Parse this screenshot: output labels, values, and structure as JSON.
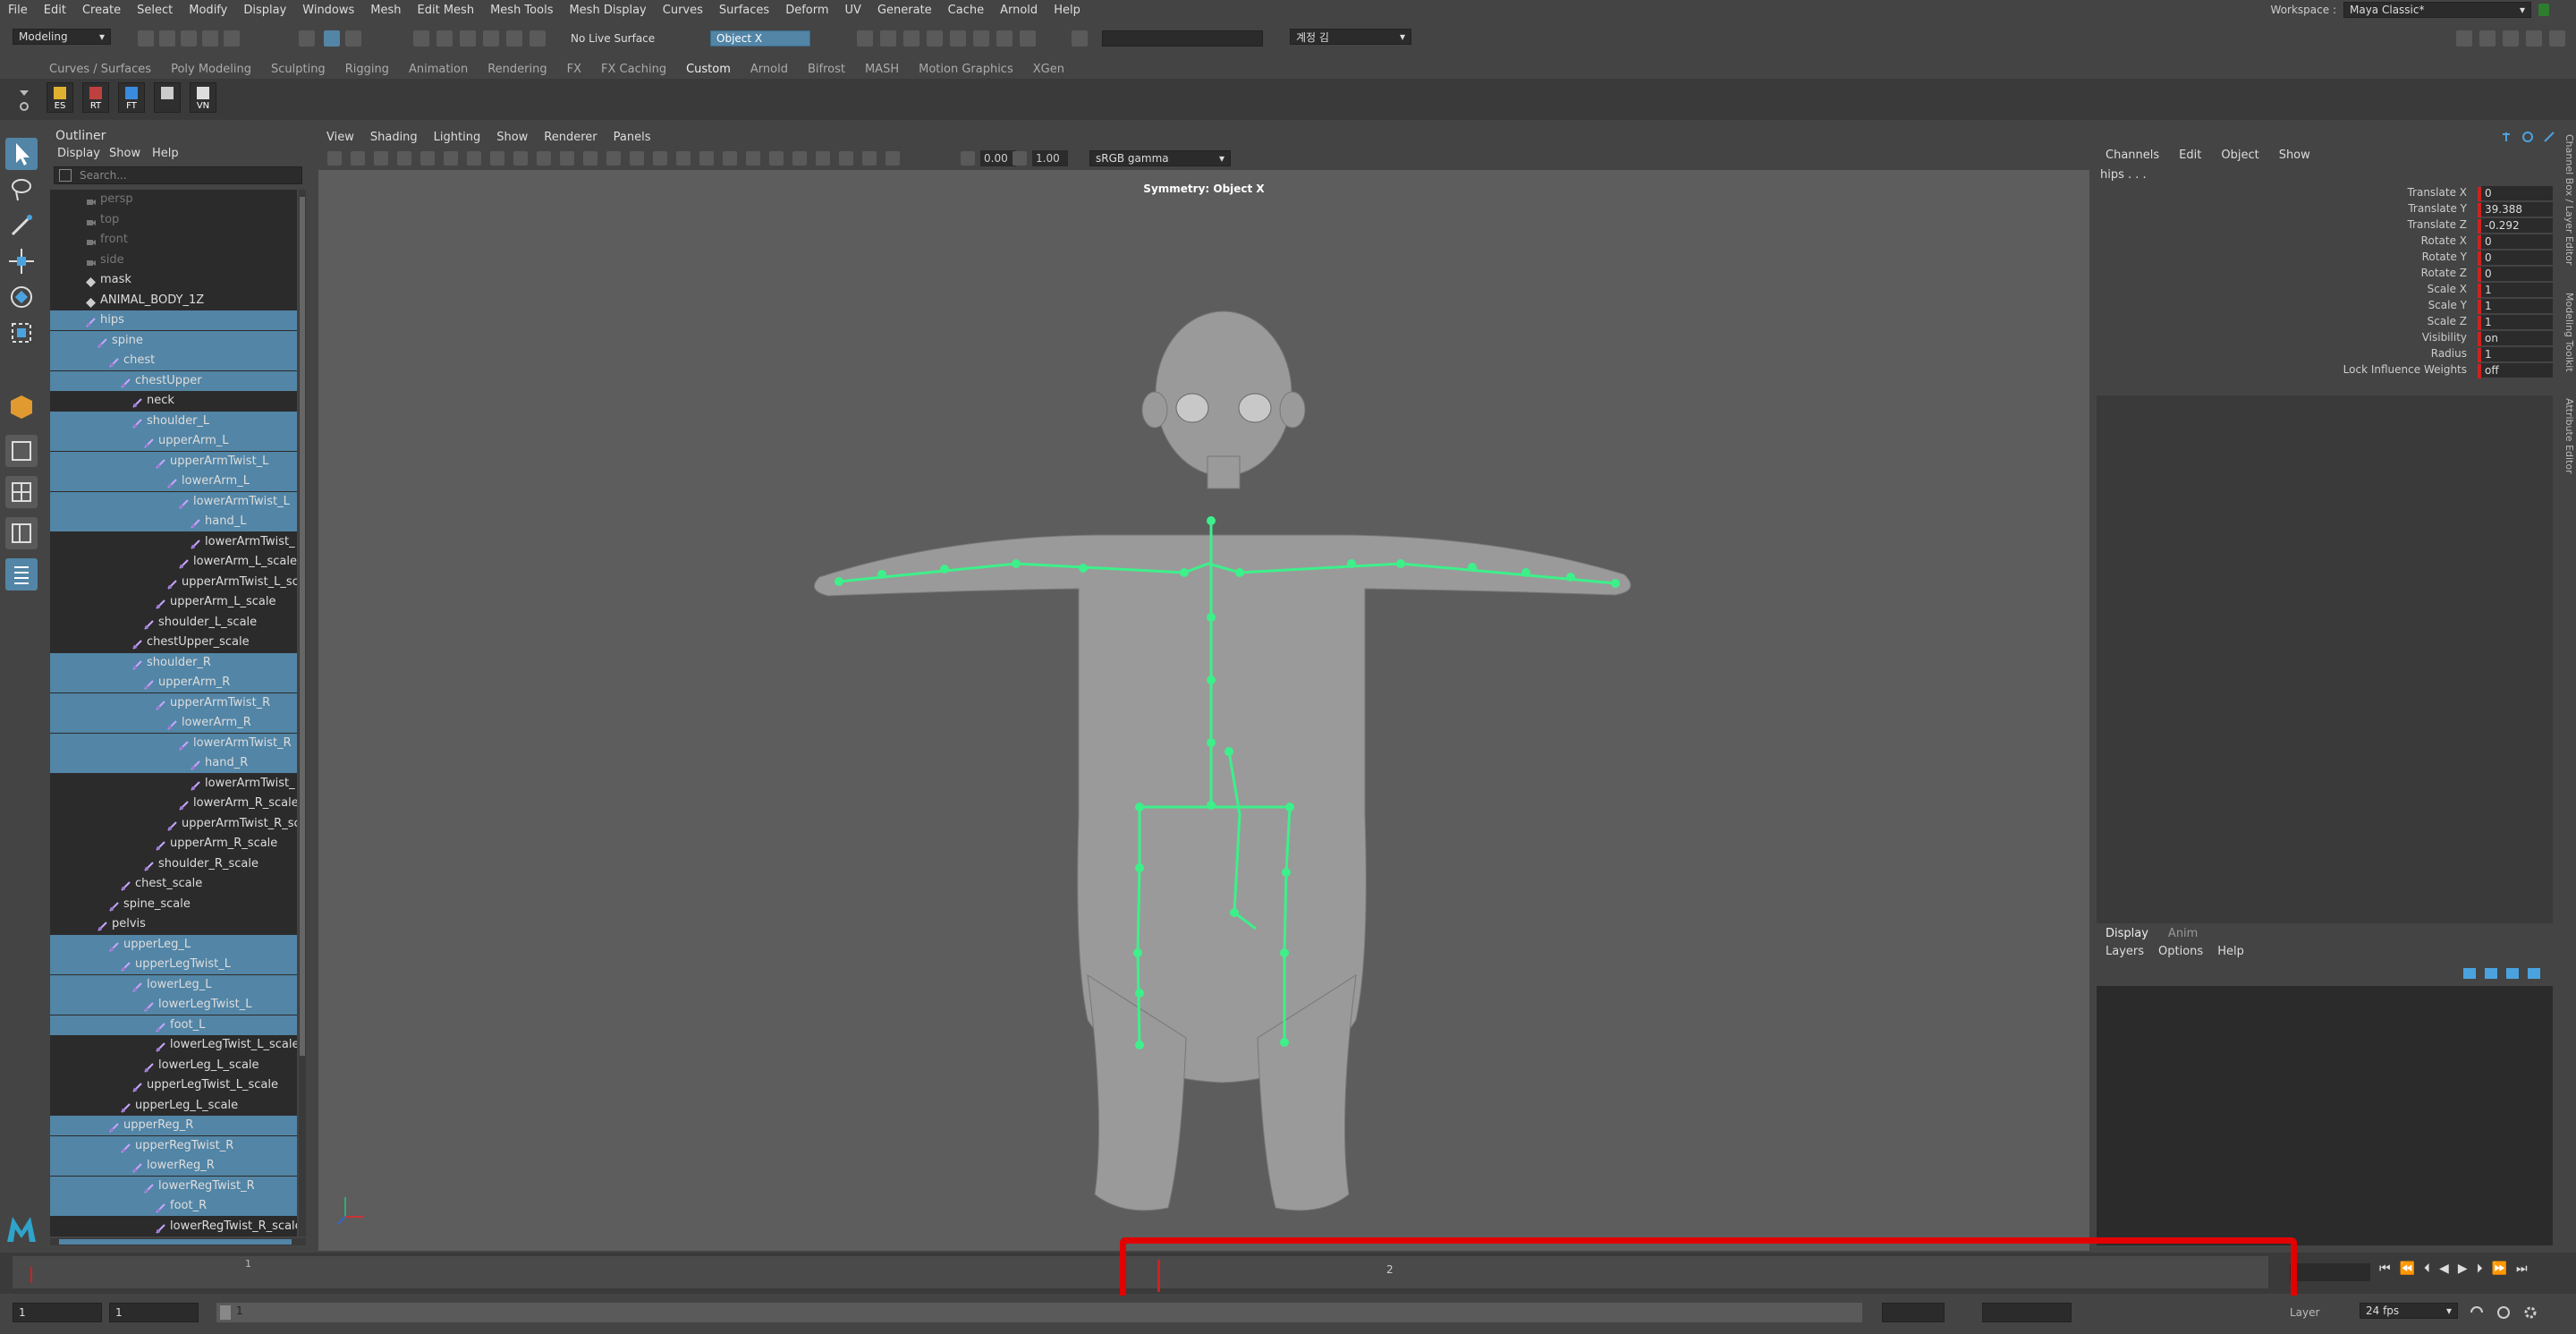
{
  "menubar": {
    "items": [
      "File",
      "Edit",
      "Create",
      "Select",
      "Modify",
      "Display",
      "Windows",
      "Mesh",
      "Edit Mesh",
      "Mesh Tools",
      "Mesh Display",
      "Curves",
      "Surfaces",
      "Deform",
      "UV",
      "Generate",
      "Cache",
      "Arnold",
      "Help"
    ],
    "workspace_label": "Workspace :",
    "workspace_value": "Maya Classic*"
  },
  "statusline": {
    "mode": "Modeling",
    "live_surface": "No Live Surface",
    "symmetry": "Object X",
    "user": "계정 김"
  },
  "shelf": {
    "tabs": [
      "Curves / Surfaces",
      "Poly Modeling",
      "Sculpting",
      "Rigging",
      "Animation",
      "Rendering",
      "FX",
      "FX Caching",
      "Custom",
      "Arnold",
      "Bifrost",
      "MASH",
      "Motion Graphics",
      "XGen"
    ],
    "active_tab": "Custom",
    "icons": [
      "ES",
      "RT",
      "FT",
      "",
      "VN"
    ]
  },
  "outliner": {
    "title": "Outliner",
    "menu": [
      "Display",
      "Show",
      "Help"
    ],
    "search_placeholder": "Search...",
    "rows": [
      {
        "label": "persp",
        "depth": 0,
        "type": "camera",
        "sel": false,
        "dim": true
      },
      {
        "label": "top",
        "depth": 0,
        "type": "camera",
        "sel": false,
        "dim": true
      },
      {
        "label": "front",
        "depth": 0,
        "type": "camera",
        "sel": false,
        "dim": true
      },
      {
        "label": "side",
        "depth": 0,
        "type": "camera",
        "sel": false,
        "dim": true
      },
      {
        "label": "mask",
        "depth": 0,
        "type": "mesh",
        "sel": false,
        "dim": false
      },
      {
        "label": "ANIMAL_BODY_1Z",
        "depth": 0,
        "type": "mesh",
        "sel": false,
        "dim": false
      },
      {
        "label": "hips",
        "depth": 0,
        "type": "joint",
        "sel": true,
        "dim": false
      },
      {
        "label": "spine",
        "depth": 1,
        "type": "joint",
        "sel": true,
        "dim": false
      },
      {
        "label": "chest",
        "depth": 2,
        "type": "joint",
        "sel": true,
        "dim": false
      },
      {
        "label": "chestUpper",
        "depth": 3,
        "type": "joint",
        "sel": true,
        "dim": false
      },
      {
        "label": "neck",
        "depth": 4,
        "type": "joint",
        "sel": false,
        "dim": false
      },
      {
        "label": "shoulder_L",
        "depth": 4,
        "type": "joint",
        "sel": true,
        "dim": false
      },
      {
        "label": "upperArm_L",
        "depth": 5,
        "type": "joint",
        "sel": true,
        "dim": false
      },
      {
        "label": "upperArmTwist_L",
        "depth": 6,
        "type": "joint",
        "sel": true,
        "dim": false
      },
      {
        "label": "lowerArm_L",
        "depth": 7,
        "type": "joint",
        "sel": true,
        "dim": false
      },
      {
        "label": "lowerArmTwist_L",
        "depth": 8,
        "type": "joint",
        "sel": true,
        "dim": false
      },
      {
        "label": "hand_L",
        "depth": 9,
        "type": "joint",
        "sel": true,
        "dim": false
      },
      {
        "label": "lowerArmTwist_",
        "depth": 9,
        "type": "joint",
        "sel": false,
        "dim": false
      },
      {
        "label": "lowerArm_L_scale",
        "depth": 8,
        "type": "joint",
        "sel": false,
        "dim": false
      },
      {
        "label": "upperArmTwist_L_sc",
        "depth": 7,
        "type": "joint",
        "sel": false,
        "dim": false
      },
      {
        "label": "upperArm_L_scale",
        "depth": 6,
        "type": "joint",
        "sel": false,
        "dim": false
      },
      {
        "label": "shoulder_L_scale",
        "depth": 5,
        "type": "joint",
        "sel": false,
        "dim": false
      },
      {
        "label": "chestUpper_scale",
        "depth": 4,
        "type": "joint",
        "sel": false,
        "dim": false
      },
      {
        "label": "shoulder_R",
        "depth": 4,
        "type": "joint",
        "sel": true,
        "dim": false
      },
      {
        "label": "upperArm_R",
        "depth": 5,
        "type": "joint",
        "sel": true,
        "dim": false
      },
      {
        "label": "upperArmTwist_R",
        "depth": 6,
        "type": "joint",
        "sel": true,
        "dim": false
      },
      {
        "label": "lowerArm_R",
        "depth": 7,
        "type": "joint",
        "sel": true,
        "dim": false
      },
      {
        "label": "lowerArmTwist_R",
        "depth": 8,
        "type": "joint",
        "sel": true,
        "dim": false
      },
      {
        "label": "hand_R",
        "depth": 9,
        "type": "joint",
        "sel": true,
        "dim": false
      },
      {
        "label": "lowerArmTwist_",
        "depth": 9,
        "type": "joint",
        "sel": false,
        "dim": false
      },
      {
        "label": "lowerArm_R_scale",
        "depth": 8,
        "type": "joint",
        "sel": false,
        "dim": false
      },
      {
        "label": "upperArmTwist_R_sc",
        "depth": 7,
        "type": "joint",
        "sel": false,
        "dim": false
      },
      {
        "label": "upperArm_R_scale",
        "depth": 6,
        "type": "joint",
        "sel": false,
        "dim": false
      },
      {
        "label": "shoulder_R_scale",
        "depth": 5,
        "type": "joint",
        "sel": false,
        "dim": false
      },
      {
        "label": "chest_scale",
        "depth": 3,
        "type": "joint",
        "sel": false,
        "dim": false
      },
      {
        "label": "spine_scale",
        "depth": 2,
        "type": "joint",
        "sel": false,
        "dim": false
      },
      {
        "label": "pelvis",
        "depth": 1,
        "type": "joint",
        "sel": false,
        "dim": false
      },
      {
        "label": "upperLeg_L",
        "depth": 2,
        "type": "joint",
        "sel": true,
        "dim": false
      },
      {
        "label": "upperLegTwist_L",
        "depth": 3,
        "type": "joint",
        "sel": true,
        "dim": false
      },
      {
        "label": "lowerLeg_L",
        "depth": 4,
        "type": "joint",
        "sel": true,
        "dim": false
      },
      {
        "label": "lowerLegTwist_L",
        "depth": 5,
        "type": "joint",
        "sel": true,
        "dim": false
      },
      {
        "label": "foot_L",
        "depth": 6,
        "type": "joint",
        "sel": true,
        "dim": false
      },
      {
        "label": "lowerLegTwist_L_scale",
        "depth": 6,
        "type": "joint",
        "sel": false,
        "dim": false
      },
      {
        "label": "lowerLeg_L_scale",
        "depth": 5,
        "type": "joint",
        "sel": false,
        "dim": false
      },
      {
        "label": "upperLegTwist_L_scale",
        "depth": 4,
        "type": "joint",
        "sel": false,
        "dim": false
      },
      {
        "label": "upperLeg_L_scale",
        "depth": 3,
        "type": "joint",
        "sel": false,
        "dim": false
      },
      {
        "label": "upperReg_R",
        "depth": 2,
        "type": "joint",
        "sel": true,
        "dim": false
      },
      {
        "label": "upperRegTwist_R",
        "depth": 3,
        "type": "joint",
        "sel": true,
        "dim": false
      },
      {
        "label": "lowerReg_R",
        "depth": 4,
        "type": "joint",
        "sel": true,
        "dim": false
      },
      {
        "label": "lowerRegTwist_R",
        "depth": 5,
        "type": "joint",
        "sel": true,
        "dim": false
      },
      {
        "label": "foot_R",
        "depth": 6,
        "type": "joint",
        "sel": true,
        "dim": false
      },
      {
        "label": "lowerRegTwist_R_scale",
        "depth": 6,
        "type": "joint",
        "sel": false,
        "dim": false
      }
    ]
  },
  "viewport": {
    "menu": [
      "View",
      "Shading",
      "Lighting",
      "Show",
      "Renderer",
      "Panels"
    ],
    "exposure": "0.00",
    "gamma": "1.00",
    "colorspace": "sRGB gamma",
    "symmetry_label": "Symmetry: Object X"
  },
  "channelbox": {
    "menu": [
      "Channels",
      "Edit",
      "Object",
      "Show"
    ],
    "node": "hips . . .",
    "attrs": [
      {
        "name": "Translate X",
        "value": "0"
      },
      {
        "name": "Translate Y",
        "value": "39.388"
      },
      {
        "name": "Translate Z",
        "value": "-0.292"
      },
      {
        "name": "Rotate X",
        "value": "0"
      },
      {
        "name": "Rotate Y",
        "value": "0"
      },
      {
        "name": "Rotate Z",
        "value": "0"
      },
      {
        "name": "Scale X",
        "value": "1"
      },
      {
        "name": "Scale Y",
        "value": "1"
      },
      {
        "name": "Scale Z",
        "value": "1"
      },
      {
        "name": "Visibility",
        "value": "on"
      },
      {
        "name": "Radius",
        "value": "1"
      },
      {
        "name": "Lock Influence Weights",
        "value": "off"
      }
    ],
    "side_tabs": [
      "Channel Box / Layer Editor",
      "Modeling Toolkit",
      "Attribute Editor"
    ],
    "layer_tabs": [
      "Display",
      "Anim"
    ],
    "layer_menu": [
      "Layers",
      "Options",
      "Help"
    ]
  },
  "timeslider": {
    "start_tick": "1",
    "current_frame_label": "2",
    "current_frame": 2
  },
  "rangeslider": {
    "start": "1",
    "range_start": "1",
    "range_field": "1",
    "layer": "Layer",
    "fps": "24 fps"
  },
  "colors": {
    "accent": "#5285a6",
    "joint": "#3df08a",
    "highlight": "#e30000"
  }
}
